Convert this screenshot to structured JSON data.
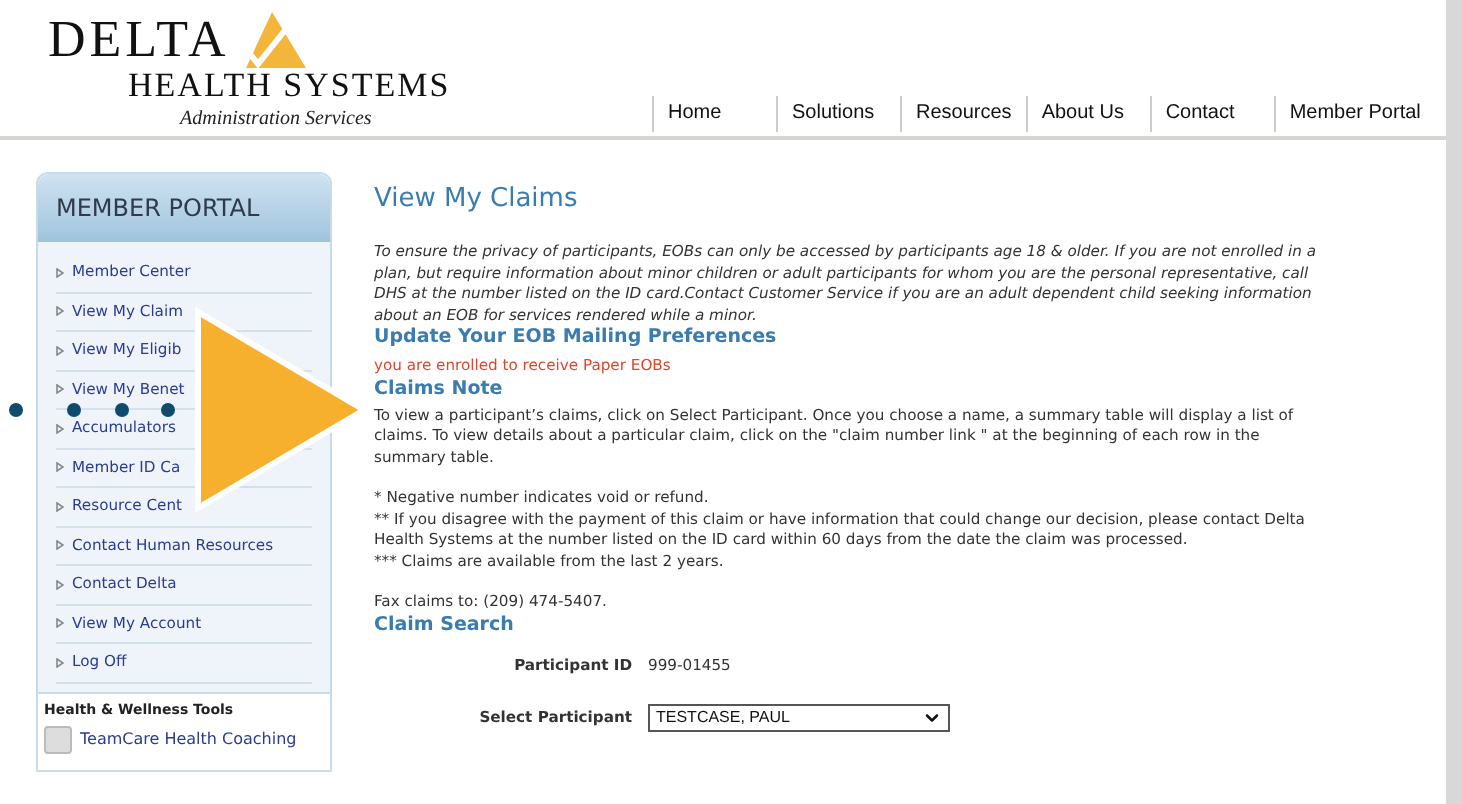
{
  "logo": {
    "brand": "DELTA",
    "subtitle": "HEALTH SYSTEMS",
    "tagline": "Administration Services"
  },
  "nav": [
    "Home",
    "Solutions",
    "Resources",
    "About Us",
    "Contact",
    "Member Portal"
  ],
  "sidebar": {
    "title": "MEMBER PORTAL",
    "items": [
      "Member Center",
      "View My Claim",
      "View My Eligib",
      "View My Benet",
      "Accumulators",
      "Member ID Ca",
      "Resource Cent",
      "Contact Human Resources",
      "Contact Delta",
      "View My Account",
      "Log Off"
    ],
    "tools_title": "Health & Wellness Tools",
    "tools": [
      "TeamCare Health Coaching"
    ]
  },
  "main": {
    "title": "View My Claims",
    "privacy_note": "To ensure the privacy of participants, EOBs can only be accessed by participants age 18 & older. If you are not enrolled in a plan, but require information about minor children or adult participants for whom you are the personal representative, call DHS at the number listed on the ID card.Contact Customer Service if you are an adult dependent child seeking information about an EOB for services rendered while a minor.",
    "mailing_heading": "Update Your EOB Mailing Preferences",
    "mailing_status": "you are enrolled to receive Paper EOBs",
    "notes_heading": "Claims Note",
    "notes_intro": "To view a participant’s claims, click on Select Participant. Once you choose a name, a summary table will display a list of claims. To view details about a particular claim, click on the \"claim number link \" at the beginning of each row in the summary table.",
    "footnotes": [
      "* Negative number indicates void or refund.",
      "** If you disagree with the payment of this claim or have information that could change our decision, please contact Delta Health Systems at the number listed on the ID card within 60 days from the date the claim was processed.",
      "*** Claims are available from the last 2 years."
    ],
    "fax": "Fax claims to: (209) 474-5407.",
    "search_heading": "Claim Search",
    "participant_id_label": "Participant ID",
    "participant_id": "999-01455",
    "select_label": "Select Participant",
    "select_value": "TESTCASE, PAUL"
  }
}
